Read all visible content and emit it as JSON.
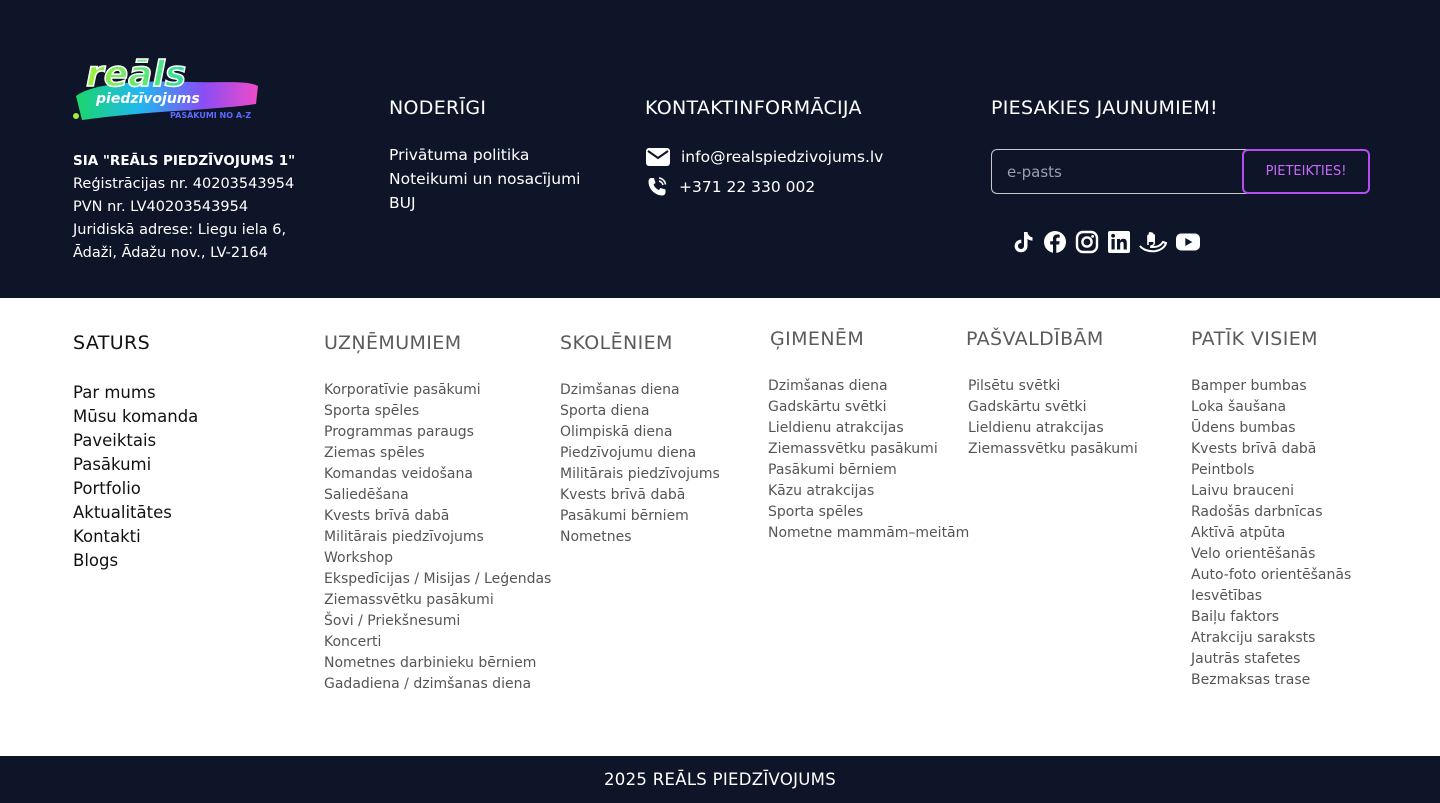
{
  "logo": {
    "word": "reāls",
    "sub": "piedzīvojums",
    "tagline": "PASĀKUMI NO A-Z"
  },
  "company": {
    "name": "SIA \"REĀLS PIEDZĪVOJUMS 1\"",
    "reg": "Reģistrācijas nr. 40203543954",
    "pvn": "PVN nr. LV40203543954",
    "address1": "Juridiskā adrese: Liegu iela 6,",
    "address2": "Ādaži, Ādažu nov., LV-2164"
  },
  "noderigi": {
    "title": "NODERĪGI",
    "links": [
      "Privātuma politika",
      "Noteikumi un nosacījumi",
      "BUJ"
    ]
  },
  "kontakti": {
    "title": "KONTAKTINFORMĀCIJA",
    "email": "info@realspiedzivojums.lv",
    "phone": "+371 22 330 002"
  },
  "newsletter": {
    "title": "PIESAKIES JAUNUMIEM!",
    "placeholder": "e-pasts",
    "button": "PIETEIKTIES!"
  },
  "socials": [
    "tiktok-icon",
    "facebook-icon",
    "instagram-icon",
    "linkedin-icon",
    "hands-icon",
    "youtube-icon"
  ],
  "saturs": {
    "title": "SATURS",
    "links": [
      "Par mums",
      "Mūsu komanda",
      "Paveiktais",
      "Pasākumi",
      "Portfolio",
      "Aktualitātes",
      "Kontakti",
      "Blogs"
    ]
  },
  "uznemumiem": {
    "title": "UZŅĒMUMIEM",
    "links": [
      "Korporatīvie pasākumi",
      "Sporta spēles",
      "Programmas paraugs",
      "Ziemas spēles",
      "Komandas veidošana",
      "Saliedēšana",
      "Kvests brīvā dabā",
      "Militārais piedzīvojums",
      "Workshop",
      "Ekspedīcijas / Misijas / Leģendas",
      "Ziemassvētku pasākumi",
      "Šovi / Priekšnesumi",
      "Koncerti",
      "Nometnes darbinieku bērniem",
      "Gadadiena / dzimšanas diena"
    ]
  },
  "skoleniem": {
    "title": "SKOLĒNIEM",
    "links": [
      "Dzimšanas diena",
      "Sporta diena",
      "Olimpiskā diena",
      "Piedzīvojumu diena",
      "Militārais piedzīvojums",
      "Kvests brīvā dabā",
      "Pasākumi bērniem",
      "Nometnes"
    ]
  },
  "gimenem": {
    "title": "ĢIMENĒM",
    "links": [
      "Dzimšanas diena",
      "Gadskārtu svētki",
      "Lieldienu atrakcijas",
      "Ziemassvētku pasākumi",
      "Pasākumi bērniem",
      "Kāzu atrakcijas",
      "Sporta spēles",
      "Nometne mammām–meitām"
    ]
  },
  "pasvaldibam": {
    "title": "PAŠVALDĪBĀM",
    "links": [
      "Pilsētu svētki",
      "Gadskārtu svētki",
      "Lieldienu atrakcijas",
      "Ziemassvētku pasākumi"
    ]
  },
  "patik": {
    "title": "PATĪK VISIEM",
    "links": [
      "Bamper bumbas",
      "Loka šaušana",
      "Ūdens bumbas",
      "Kvests brīvā dabā",
      "Peintbols",
      "Laivu brauceni",
      "Radošās darbnīcas",
      "Aktīvā atpūta",
      "Velo orientēšanās",
      "Auto-foto orientēšanās",
      "Iesvētības",
      "Baiļu faktors",
      "Atrakciju saraksts",
      "Jautrās stafetes",
      "Bezmaksas trase"
    ]
  },
  "copyright": "2025 REĀLS PIEDZĪVOJUMS"
}
